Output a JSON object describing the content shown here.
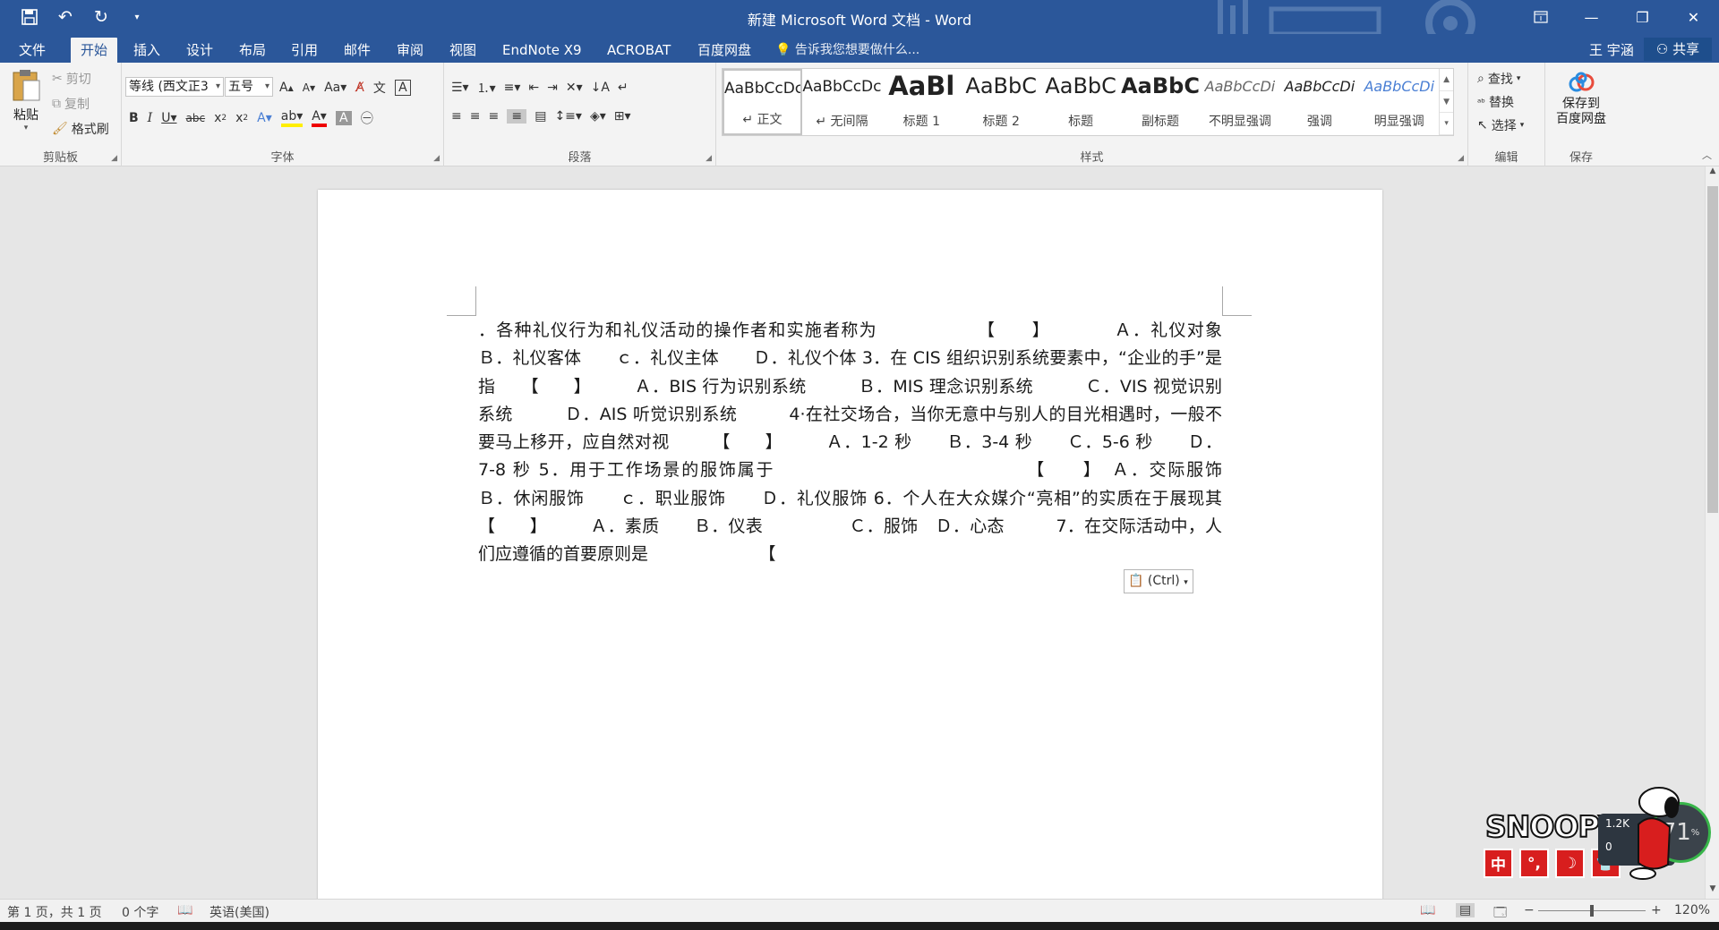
{
  "window": {
    "title": "新建 Microsoft Word 文档 - Word",
    "qat": {
      "save_icon": "save-icon",
      "undo_icon": "undo-icon",
      "redo_icon": "redo-icon",
      "customize_icon": "customize-qat-icon"
    }
  },
  "tabs": {
    "items": [
      "文件",
      "开始",
      "插入",
      "设计",
      "布局",
      "引用",
      "邮件",
      "审阅",
      "视图",
      "EndNote X9",
      "ACROBAT",
      "百度网盘"
    ],
    "active": "开始",
    "tell_me": "告诉我您想要做什么...",
    "user": "王 宇涵",
    "share": "共享"
  },
  "ribbon": {
    "clipboard": {
      "label": "剪贴板",
      "paste": "粘贴",
      "cut": "剪切",
      "copy": "复制",
      "format_painter": "格式刷"
    },
    "font": {
      "label": "字体",
      "font_name": "等线 (西文正3",
      "font_size": "五号"
    },
    "paragraph": {
      "label": "段落"
    },
    "styles": {
      "label": "样式",
      "items": [
        {
          "preview": "AaBbCcDc",
          "name": "↵ 正文"
        },
        {
          "preview": "AaBbCcDc",
          "name": "↵ 无间隔"
        },
        {
          "preview": "AaBl",
          "name": "标题 1"
        },
        {
          "preview": "AaBbC",
          "name": "标题 2"
        },
        {
          "preview": "AaBbC",
          "name": "标题"
        },
        {
          "preview": "AaBbC",
          "name": "副标题"
        },
        {
          "preview": "AaBbCcDi",
          "name": "不明显强调"
        },
        {
          "preview": "AaBbCcDi",
          "name": "强调"
        },
        {
          "preview": "AaBbCcDi",
          "name": "明显强调"
        }
      ]
    },
    "editing": {
      "label": "编辑",
      "find": "查找",
      "replace": "替换",
      "select": "选择"
    },
    "save": {
      "label": "保存",
      "button": "保存到\n百度网盘"
    }
  },
  "document": {
    "text": "．各种礼仪行为和礼仪活动的操作者和实施者称为　　　　　　【　　】　　　　Ａ．礼仪对象　Ｂ．礼仪客体　　ｃ．礼仪主体　　Ｄ．礼仪个体 3．在 CIS 组织识别系统要素中，“企业的手”是指　　【　　】　　　Ａ．BIS 行为识别系统　　　Ｂ．MIS 理念识别系统　　　Ｃ．VIS 视觉识别系统　　　Ｄ．AIS 听觉识别系统　　　4·在社交场合，当你无意中与别人的目光相遇时，一般不要马上移开，应自然对视　　　【　　】　　　Ａ．1-2 秒　　Ｂ．3-4 秒　　Ｃ．5-6 秒　　Ｄ．7-8 秒 5．用于工作场景的服饰属于　　　　　　　　　　　　　　【　　】　Ａ．交际服饰　　Ｂ．休闲服饰　　ｃ．职业服饰　　Ｄ．礼仪服饰 6．个人在大众媒介“亮相”的实质在于展现其　　　　　【　　】　　　Ａ．素质　　Ｂ．仪表　　　　　Ｃ．服饰　Ｄ．心态　　　7．在交际活动中，人们应遵循的首要原则是　　　　　　　【",
    "paste_options": "(Ctrl)"
  },
  "statusbar": {
    "page": "第 1 页，共 1 页",
    "words": "0 个字",
    "language": "英语(美国)",
    "zoom": "120%"
  },
  "widget": {
    "logo": "SNOOPY",
    "buttons": [
      "中",
      "°,",
      "☽",
      "👕"
    ],
    "speed_top": "1.2K",
    "speed_bottom": "0",
    "gauge": "71"
  }
}
